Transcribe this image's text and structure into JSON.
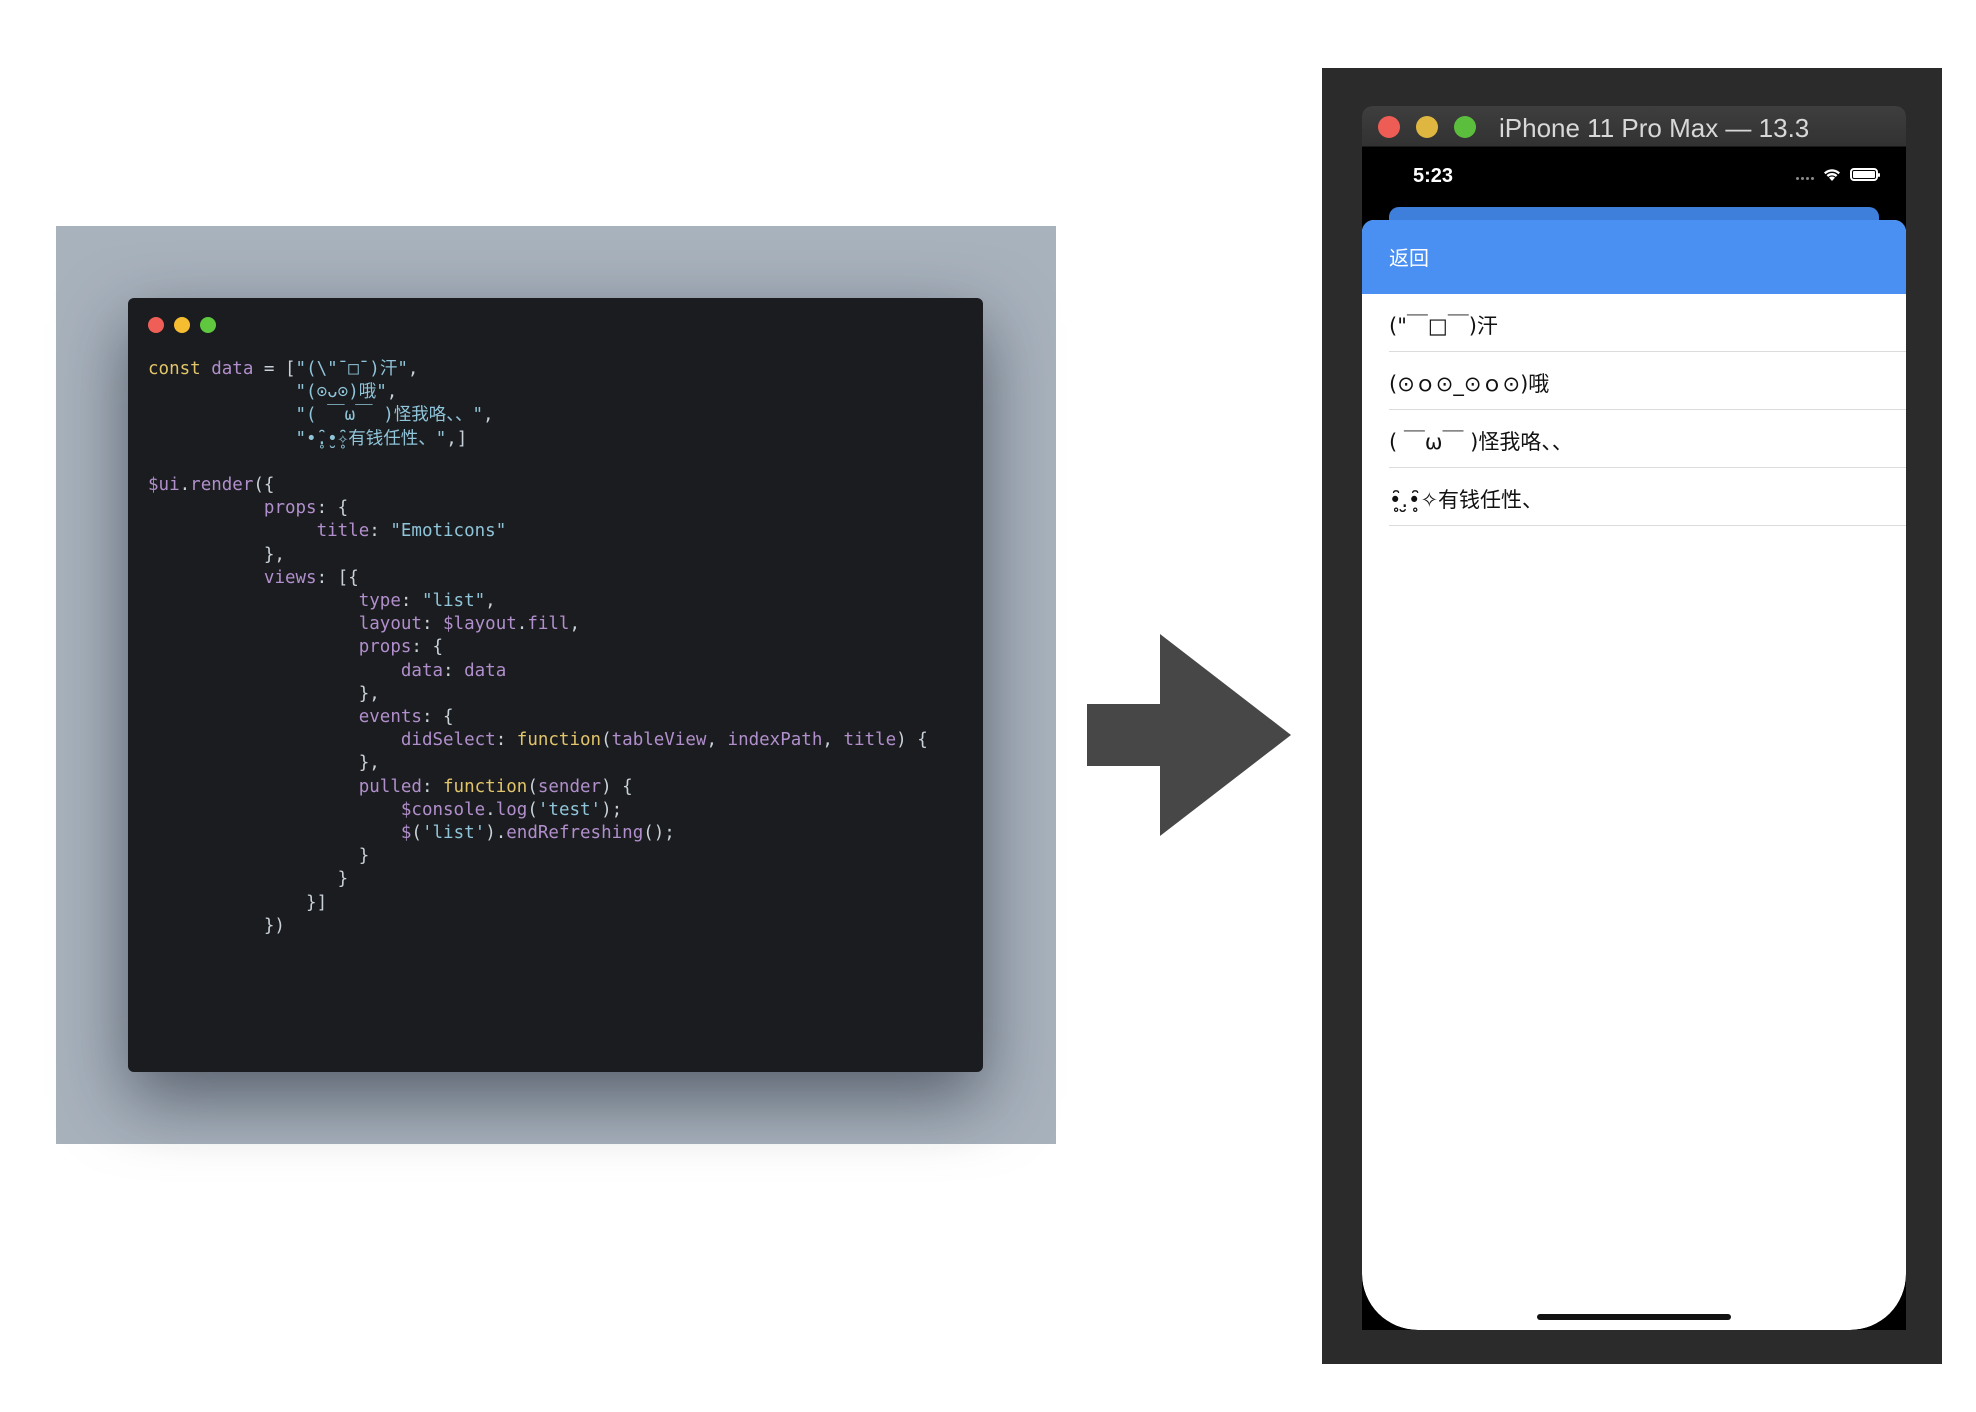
{
  "code_window": {
    "traffic_colors": [
      "#ef5f57",
      "#f5bd30",
      "#5fc83f"
    ],
    "lines": [
      [
        {
          "t": "const ",
          "c": "kw"
        },
        {
          "t": "data",
          "c": "vr"
        },
        {
          "t": " = [",
          "c": "pn"
        },
        {
          "t": "\"(\\\"¯□¯)汗\"",
          "c": "st"
        },
        {
          "t": ",",
          "c": "pn"
        }
      ],
      [
        {
          "t": "              ",
          "c": "pn"
        },
        {
          "t": "\"(⊙ᴗ⊙)哦\"",
          "c": "st"
        },
        {
          "t": ",",
          "c": "pn"
        }
      ],
      [
        {
          "t": "              ",
          "c": "pn"
        },
        {
          "t": "\"( ￣ω￣ )怪我咯、、\"",
          "c": "st"
        },
        {
          "t": ",",
          "c": "pn"
        }
      ],
      [
        {
          "t": "              ",
          "c": "pn"
        },
        {
          "t": "\"•̥̑.̮•̥̑✧有钱任性、\"",
          "c": "st"
        },
        {
          "t": ",]",
          "c": "pn"
        }
      ],
      [
        {
          "t": "",
          "c": "pn"
        }
      ],
      [
        {
          "t": "$ui",
          "c": "vr"
        },
        {
          "t": ".",
          "c": "pn"
        },
        {
          "t": "render",
          "c": "vr"
        },
        {
          "t": "({",
          "c": "pn"
        }
      ],
      [
        {
          "t": "           ",
          "c": "pn"
        },
        {
          "t": "props",
          "c": "vr"
        },
        {
          "t": ": {",
          "c": "pn"
        }
      ],
      [
        {
          "t": "                ",
          "c": "pn"
        },
        {
          "t": "title",
          "c": "vr"
        },
        {
          "t": ": ",
          "c": "pn"
        },
        {
          "t": "\"Emoticons\"",
          "c": "st"
        }
      ],
      [
        {
          "t": "           },",
          "c": "pn"
        }
      ],
      [
        {
          "t": "           ",
          "c": "pn"
        },
        {
          "t": "views",
          "c": "vr"
        },
        {
          "t": ": [{",
          "c": "pn"
        }
      ],
      [
        {
          "t": "                    ",
          "c": "pn"
        },
        {
          "t": "type",
          "c": "vr"
        },
        {
          "t": ": ",
          "c": "pn"
        },
        {
          "t": "\"list\"",
          "c": "st"
        },
        {
          "t": ",",
          "c": "pn"
        }
      ],
      [
        {
          "t": "                    ",
          "c": "pn"
        },
        {
          "t": "layout",
          "c": "vr"
        },
        {
          "t": ": ",
          "c": "pn"
        },
        {
          "t": "$layout",
          "c": "vr"
        },
        {
          "t": ".",
          "c": "pn"
        },
        {
          "t": "fill",
          "c": "vr"
        },
        {
          "t": ",",
          "c": "pn"
        }
      ],
      [
        {
          "t": "                    ",
          "c": "pn"
        },
        {
          "t": "props",
          "c": "vr"
        },
        {
          "t": ": {",
          "c": "pn"
        }
      ],
      [
        {
          "t": "                        ",
          "c": "pn"
        },
        {
          "t": "data",
          "c": "vr"
        },
        {
          "t": ": ",
          "c": "pn"
        },
        {
          "t": "data",
          "c": "vr"
        }
      ],
      [
        {
          "t": "                    },",
          "c": "pn"
        }
      ],
      [
        {
          "t": "                    ",
          "c": "pn"
        },
        {
          "t": "events",
          "c": "vr"
        },
        {
          "t": ": {",
          "c": "pn"
        }
      ],
      [
        {
          "t": "                        ",
          "c": "pn"
        },
        {
          "t": "didSelect",
          "c": "vr"
        },
        {
          "t": ": ",
          "c": "pn"
        },
        {
          "t": "function",
          "c": "fn"
        },
        {
          "t": "(",
          "c": "pn"
        },
        {
          "t": "tableView",
          "c": "vr"
        },
        {
          "t": ", ",
          "c": "pn"
        },
        {
          "t": "indexPath",
          "c": "vr"
        },
        {
          "t": ", ",
          "c": "pn"
        },
        {
          "t": "title",
          "c": "vr"
        },
        {
          "t": ") {",
          "c": "pn"
        }
      ],
      [
        {
          "t": "                    },",
          "c": "pn"
        }
      ],
      [
        {
          "t": "                    ",
          "c": "pn"
        },
        {
          "t": "pulled",
          "c": "vr"
        },
        {
          "t": ": ",
          "c": "pn"
        },
        {
          "t": "function",
          "c": "fn"
        },
        {
          "t": "(",
          "c": "pn"
        },
        {
          "t": "sender",
          "c": "vr"
        },
        {
          "t": ") {",
          "c": "pn"
        }
      ],
      [
        {
          "t": "                        ",
          "c": "pn"
        },
        {
          "t": "$console",
          "c": "vr"
        },
        {
          "t": ".",
          "c": "pn"
        },
        {
          "t": "log",
          "c": "vr"
        },
        {
          "t": "(",
          "c": "pn"
        },
        {
          "t": "'test'",
          "c": "st"
        },
        {
          "t": ");",
          "c": "pn"
        }
      ],
      [
        {
          "t": "                        ",
          "c": "pn"
        },
        {
          "t": "$",
          "c": "vr"
        },
        {
          "t": "(",
          "c": "pn"
        },
        {
          "t": "'list'",
          "c": "st"
        },
        {
          "t": ").",
          "c": "pn"
        },
        {
          "t": "endRefreshing",
          "c": "vr"
        },
        {
          "t": "();",
          "c": "pn"
        }
      ],
      [
        {
          "t": "                    }",
          "c": "pn"
        }
      ],
      [
        {
          "t": "                  }",
          "c": "pn"
        }
      ],
      [
        {
          "t": "               }]",
          "c": "pn"
        }
      ],
      [
        {
          "t": "           })",
          "c": "pn"
        }
      ]
    ]
  },
  "arrow": {
    "color": "#474747"
  },
  "simulator": {
    "title": "iPhone 11 Pro Max — 13.3",
    "traffic_colors": [
      "#ee5d55",
      "#dfb740",
      "#5bbf3d"
    ],
    "status_time": "5:23",
    "nav_back_label": "返回",
    "nav_color": "#4a8ff2",
    "list_items": [
      "(\"￣□￣)汗",
      "(⊙ｏ⊙_⊙ｏ⊙)哦",
      "( ￣ω￣ )怪我咯、、",
      "•̥̑.̮•̥̑✧有钱任性、"
    ]
  }
}
